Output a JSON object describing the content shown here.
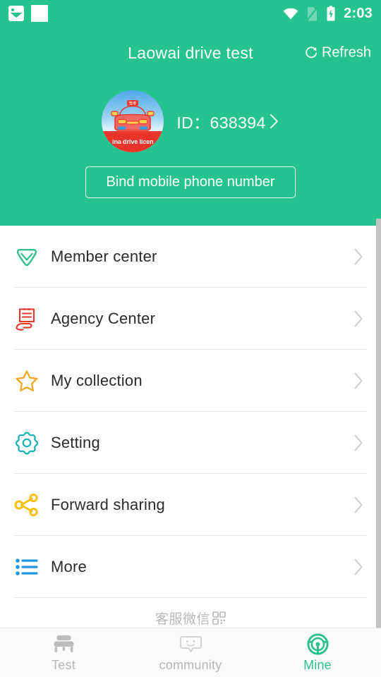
{
  "theme": {
    "brand_green": "#26c28f",
    "accent_green": "#2ec08c",
    "text_dark": "#2b2b2b",
    "text_muted": "#b5b5b5",
    "divider": "#e6e6e6",
    "scrollbar": "#c2c2c2"
  },
  "status_bar": {
    "time": "2:03",
    "icons_left": [
      "photo-icon",
      "blank-notification-icon"
    ],
    "icons_right": [
      "wifi-icon",
      "sim-off-icon",
      "battery-charging-icon"
    ]
  },
  "header": {
    "title": "Laowai drive test",
    "refresh_label": "Refresh",
    "refresh_icon": "refresh-icon"
  },
  "profile": {
    "avatar_icon": "car-license-avatar",
    "avatar_caption": "ina drive licen",
    "id_label": "ID：638394",
    "chevron_icon": "chevron-right-icon",
    "bind_button_label": "Bind mobile phone number"
  },
  "menu": {
    "items": [
      {
        "label": "Member center",
        "icon": "diamond-icon",
        "icon_color": "#2ec08c",
        "chevron_icon": "chevron-right-icon"
      },
      {
        "label": "Agency Center",
        "icon": "document-hand-icon",
        "icon_color": "#e8342b",
        "chevron_icon": "chevron-right-icon"
      },
      {
        "label": "My collection",
        "icon": "star-icon",
        "icon_color": "#f5a623",
        "chevron_icon": "chevron-right-icon"
      },
      {
        "label": "Setting",
        "icon": "gear-icon",
        "icon_color": "#16b3b3",
        "chevron_icon": "chevron-right-icon"
      },
      {
        "label": "Forward sharing",
        "icon": "share-icon",
        "icon_color": "#fcc013",
        "chevron_icon": "chevron-right-icon"
      },
      {
        "label": "More",
        "icon": "list-icon",
        "icon_color": "#2196e0",
        "chevron_icon": "chevron-right-icon"
      }
    ],
    "service_label": "客服微信",
    "service_icon": "qr-code-icon"
  },
  "tabbar": {
    "tabs": [
      {
        "label": "Test",
        "icon": "car-icon",
        "active": false
      },
      {
        "label": "community",
        "icon": "smiley-bubble-icon",
        "active": false
      },
      {
        "label": "Mine",
        "icon": "steering-wheel-icon",
        "active": true
      }
    ]
  }
}
